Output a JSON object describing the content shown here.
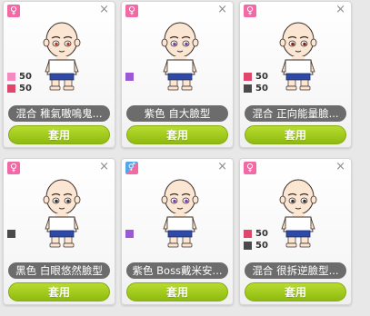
{
  "cards": [
    {
      "gender_icon": "female-icon",
      "gender_glyph": "♀",
      "name": "混合 稚氣嗷嗚鬼...",
      "button": "套用",
      "swatches": [
        {
          "color": "#f48ac0",
          "value": "50"
        },
        {
          "color": "#e0466a",
          "value": "50"
        }
      ],
      "eye_color": "#c0392b"
    },
    {
      "gender_icon": "female-icon",
      "gender_glyph": "♀",
      "name": "紫色 自大臉型",
      "button": "套用",
      "swatches": [
        {
          "color": "#9b59d6",
          "value": ""
        }
      ],
      "eye_color": "#7d3fb2"
    },
    {
      "gender_icon": "female-icon",
      "gender_glyph": "♀",
      "name": "混合 正向能量臉...",
      "button": "套用",
      "swatches": [
        {
          "color": "#e0466a",
          "value": "50"
        },
        {
          "color": "#4a4a4a",
          "value": "50"
        }
      ],
      "eye_color": "#8b1a1a"
    },
    {
      "gender_icon": "female-icon",
      "gender_glyph": "♀",
      "name": "黑色 白眼悠然臉型",
      "button": "套用",
      "swatches": [
        {
          "color": "#4a4a4a",
          "value": ""
        }
      ],
      "eye_color": "#333333"
    },
    {
      "gender_icon": "unisex-icon",
      "gender_glyph": "⚥",
      "name": "紫色 Boss戴米安...",
      "button": "套用",
      "swatches": [
        {
          "color": "#9b59d6",
          "value": ""
        }
      ],
      "eye_color": "#7d3fb2"
    },
    {
      "gender_icon": "female-icon",
      "gender_glyph": "♀",
      "name": "混合 很拆逆臉型...",
      "button": "套用",
      "swatches": [
        {
          "color": "#e0466a",
          "value": "50"
        },
        {
          "color": "#4a4a4a",
          "value": "50"
        }
      ],
      "eye_color": "#333333"
    }
  ],
  "close_glyph": "×"
}
